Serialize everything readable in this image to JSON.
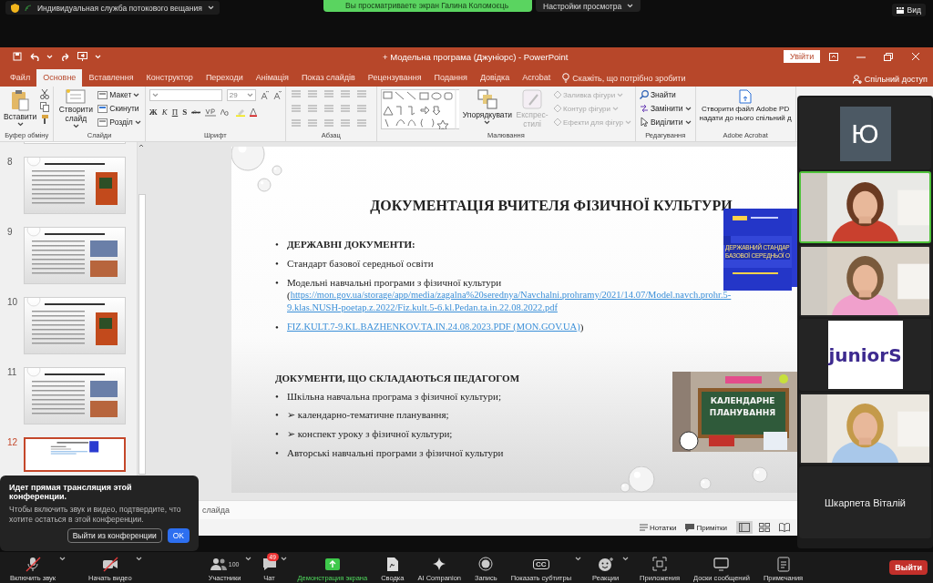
{
  "zoom_top": {
    "stream_label": "Индивидуальная служба потокового вещания",
    "banner": "Вы просматриваете экран Галина Коломоєць",
    "view_options": "Настройки просмотра",
    "view_button": "Вид"
  },
  "ppt": {
    "title": "+ Модельна програма (Джуніорс)  -  PowerPoint",
    "sign_in": "Увійти",
    "tabs": [
      {
        "label": "Файл",
        "selected": false
      },
      {
        "label": "Основне",
        "selected": true
      },
      {
        "label": "Вставлення",
        "selected": false
      },
      {
        "label": "Конструктор",
        "selected": false
      },
      {
        "label": "Переходи",
        "selected": false
      },
      {
        "label": "Анімація",
        "selected": false
      },
      {
        "label": "Показ слайдів",
        "selected": false
      },
      {
        "label": "Рецензування",
        "selected": false
      },
      {
        "label": "Подання",
        "selected": false
      },
      {
        "label": "Довідка",
        "selected": false
      },
      {
        "label": "Acrobat",
        "selected": false
      }
    ],
    "tell_me": "Скажіть, що потрібно зробити",
    "share": "Спільний доступ",
    "ribbon": {
      "groups": [
        {
          "kind": "clipboard",
          "label": "Буфер обміну",
          "big": "Вставити"
        },
        {
          "kind": "slides",
          "label": "Слайди",
          "big": "Створити слайд",
          "items": [
            "Макет",
            "Скинути",
            "Розділ"
          ]
        },
        {
          "kind": "font",
          "label": "Шрифт",
          "font_size": "29",
          "format_buttons": [
            "Ж",
            "К",
            "П",
            "S",
            "abc"
          ]
        },
        {
          "kind": "paragraph",
          "label": "Абзац"
        },
        {
          "kind": "drawing",
          "label": "Малювання",
          "arrange": "Упорядкувати",
          "quick_styles": {
            "label": "Експрес-стилі",
            "disabled": true
          },
          "items": [
            {
              "label": "Заливка фігури",
              "disabled": true
            },
            {
              "label": "Контур фігури",
              "disabled": true
            },
            {
              "label": "Ефекти для фігур",
              "disabled": true
            }
          ]
        },
        {
          "kind": "editing",
          "label": "Редагування",
          "items": [
            "Знайти",
            "Замінити",
            "Виділити"
          ]
        },
        {
          "kind": "acrobat",
          "label": "Adobe Acrobat",
          "lines": [
            "Створити файл Adobe PD",
            "надати до нього спільний д"
          ]
        }
      ]
    },
    "thumbnails": [
      {
        "number": "8",
        "selected": false
      },
      {
        "number": "9",
        "selected": false
      },
      {
        "number": "10",
        "selected": false
      },
      {
        "number": "11",
        "selected": false
      },
      {
        "number": "12",
        "selected": true
      }
    ],
    "slide": {
      "title": "ДОКУМЕНТАЦІЯ ВЧИТЕЛЯ ФІЗИЧНОЇ КУЛЬТУРИ",
      "list_1": [
        {
          "kind": "bold",
          "bullet": "•",
          "text": "ДЕРЖАВНІ ДОКУМЕНТИ:"
        },
        {
          "kind": "plain",
          "bullet": "•",
          "text": "Стандарт базової середньої освіти"
        },
        {
          "kind": "with_link",
          "bullet": "•",
          "text": "Модельні навчальні програми з фізичної культури",
          "prefix": "(",
          "link_lines": [
            "https://mon.gov.ua/storage/app/media/zagalna%20serednya/Navchalni.prohramy/2021/14.07/Model.navch.prohr.5-",
            "9.klas.NUSH-poetap.z.2022/Fiz.kult.5-6.kl.Pedan.ta.in.22.08.2022.pdf"
          ]
        },
        {
          "kind": "link",
          "bullet": "•",
          "text": "FIZ.KULT.7-9.KL.BAZHENKOV.TA.IN.24.08.2023.PDF (MON.GOV.UA)",
          "suffix": ")"
        }
      ],
      "heading_2": "ДОКУМЕНТИ, ЩО СКЛАДАЮТЬСЯ ПЕДАГОГОМ",
      "list_2": [
        {
          "bullet": "•",
          "text": "Шкільна навчальна програма з фізичної культури;"
        },
        {
          "bullet": "•",
          "text": "➢ календарно-тематичне планування;"
        },
        {
          "bullet": "•",
          "text": "➢ конспект уроку з фізичної культури;"
        },
        {
          "bullet": "•",
          "text": "Авторські навчальні програми з фізичної культури"
        }
      ],
      "cover_image": {
        "lines": [
          "ДЕРЖАВНИЙ СТАНДАР",
          "БАЗОВОЇ СЕРЕДНЬОЇ О"
        ]
      },
      "board_image": {
        "text": "КАЛЕНДАРНЕ ПЛАНУВАННЯ"
      }
    },
    "notes_placeholder": "слайда",
    "status": {
      "notes": "Нотатки",
      "comments": "Примітки",
      "views": [
        {
          "kind": "normal",
          "selected": true
        },
        {
          "kind": "sorter",
          "selected": false
        },
        {
          "kind": "reading",
          "selected": false
        }
      ]
    }
  },
  "participants": [
    {
      "kind": "avatar",
      "initial": "Ю",
      "active": false
    },
    {
      "kind": "video",
      "active": true
    },
    {
      "kind": "video",
      "active": false
    },
    {
      "kind": "logo",
      "text": "juniorS",
      "active": false
    },
    {
      "kind": "video",
      "active": false
    },
    {
      "kind": "name",
      "name": "Шкарпета Віталій",
      "active": false
    }
  ],
  "popup": {
    "title": "Идет прямая трансляция этой конференции.",
    "text": "Чтобы включить звук и видео, подтвердите, что хотите остаться в этой конференции.",
    "leave": "Выйти из конференции",
    "ok": "OK"
  },
  "toolbar": {
    "items": [
      {
        "kind": "mic",
        "label": "Включить звук",
        "off": true,
        "caret": true
      },
      {
        "kind": "video",
        "label": "Начать видео",
        "off": true,
        "caret": true
      },
      {
        "kind": "participants",
        "label": "Участники",
        "count": "100",
        "caret": true
      },
      {
        "kind": "chat",
        "label": "Чат",
        "badge": "49",
        "caret": true
      },
      {
        "kind": "share",
        "label": "Демонстрация экрана",
        "active": true,
        "caret": false
      },
      {
        "kind": "summary",
        "label": "Сводка",
        "caret": false
      },
      {
        "kind": "ai",
        "label": "AI Companion",
        "caret": false
      },
      {
        "kind": "record",
        "label": "Запись",
        "caret": false
      },
      {
        "kind": "captions",
        "label": "Показать субтитры",
        "icon_text": "CC",
        "caret": true
      },
      {
        "kind": "reactions",
        "label": "Реакции",
        "caret": true
      },
      {
        "kind": "apps",
        "label": "Приложения",
        "caret": false
      },
      {
        "kind": "boards",
        "label": "Доски сообщений",
        "caret": false
      },
      {
        "kind": "notes",
        "label": "Примечания",
        "caret": false
      }
    ],
    "leave": "Выйти"
  }
}
